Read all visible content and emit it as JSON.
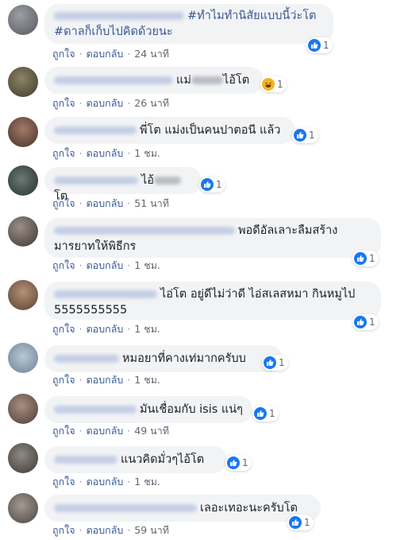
{
  "actions": {
    "like_label": "ถูกใจ",
    "reply_label": "ตอบกลับ",
    "separator": "·"
  },
  "comments": [
    {
      "text": "#ทำไมทำนิสัยแบบนี้ว่ะโต #ดาลก็เก็บไปคิดด้วยนะ",
      "line1": "#ทำไมทำนิสัยแบบนี้ว่ะโต",
      "line2": "#ดาลก็เก็บไปคิดด้วยนะ",
      "reaction": "like-icon",
      "reaction_count": "1",
      "time": "24 นาที"
    },
    {
      "text_before": "แม่",
      "text_after": "ไอ้โต",
      "reaction": "haha-icon",
      "reaction_count": "1",
      "time": "26 นาที"
    },
    {
      "text": "พี่โต แม่งเป็นคนปาตอนี แล้ว",
      "reaction": "like-icon",
      "reaction_count": "1",
      "time": "1 ชม."
    },
    {
      "text_before": "ไอ้",
      "text_after": "โต",
      "reaction": "like-icon",
      "reaction_count": "1",
      "time": "51 นาที"
    },
    {
      "line1": "พอดีอัลเลาะลืมสร้าง",
      "line2": "มารยาทให้พิธีกร",
      "reaction": "like-icon",
      "reaction_count": "1",
      "time": "1 ชม."
    },
    {
      "line1": "ไอ่โต อยู่ดีไม่ว่าดี ไอ่สเลสหมา กินหมูไป",
      "line2": "5555555555",
      "reaction": "like-icon",
      "reaction_count": "1",
      "time": "1 ชม."
    },
    {
      "text": "หมอยาที่คางเท่มากครับบ",
      "reaction": "like-icon",
      "reaction_count": "1",
      "time": "1 ชม."
    },
    {
      "text": "มันเชื่อมกับ isis แน่ๆ",
      "reaction": "like-icon",
      "reaction_count": "1",
      "time": "49 นาที"
    },
    {
      "text": "แนวคิดมั่วๆไอ้โต",
      "reaction": "like-icon",
      "reaction_count": "1",
      "time": "1 ชม."
    },
    {
      "text": "เลอะเทอะนะครับโต",
      "reaction": "like-icon",
      "reaction_count": "1",
      "time": "59 นาที"
    }
  ],
  "colors": {
    "bubble": "#f2f3f5",
    "link": "#385898",
    "meta": "#606770",
    "like": "#1877f2",
    "haha": "#f7b125"
  }
}
